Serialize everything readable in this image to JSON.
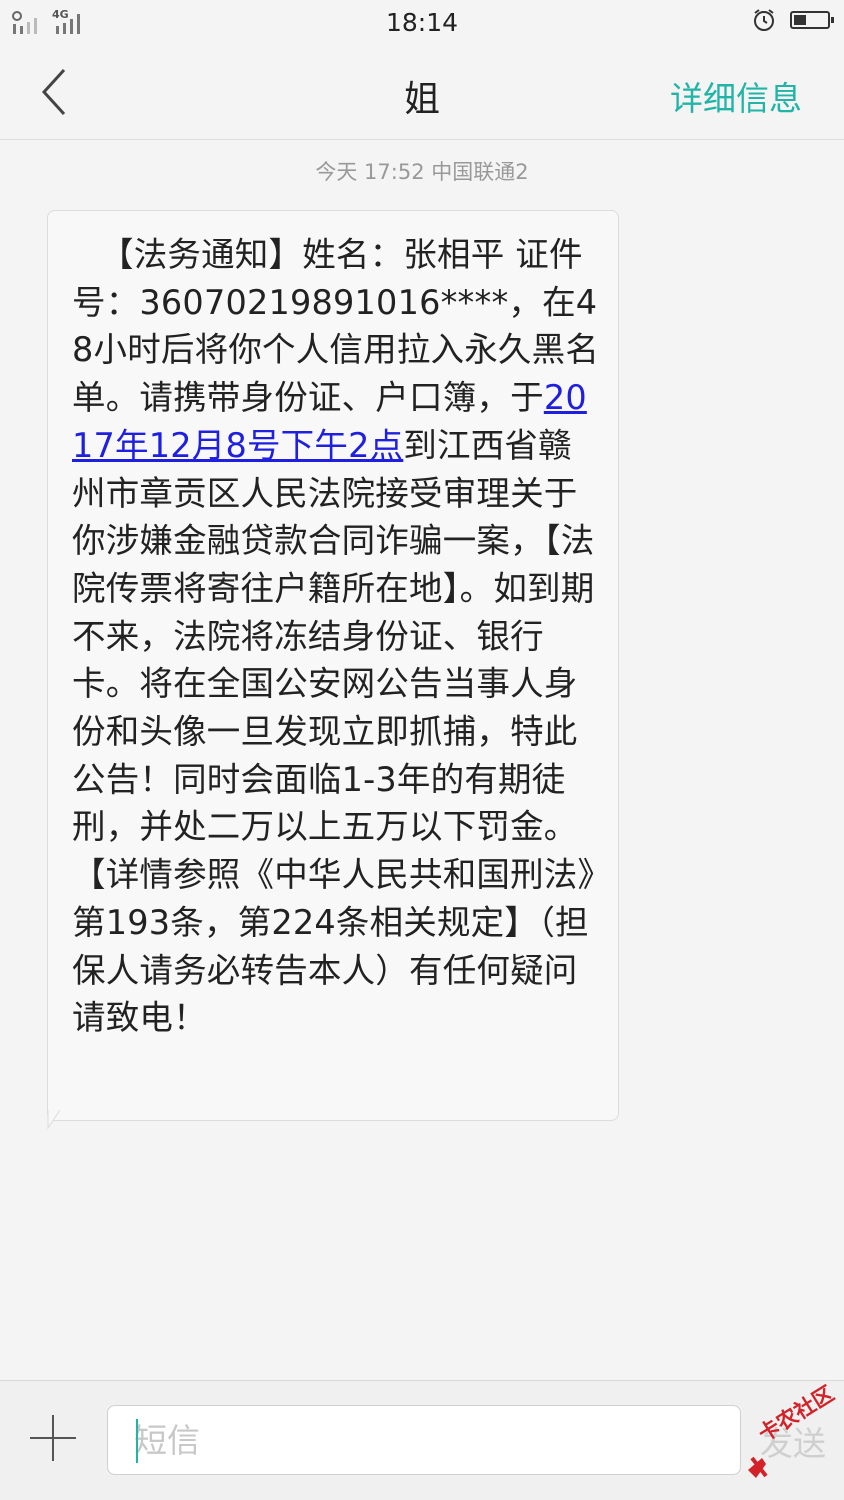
{
  "status_bar": {
    "network_label": "4G",
    "time": "18:14"
  },
  "header": {
    "title": "姐",
    "detail_label": "详细信息"
  },
  "conversation": {
    "timestamp": "今天  17:52  中国联通2",
    "message": {
      "part1": "【法务通知】姓名：张相平 证件号：36070219891016****，在48小时后将你个人信用拉入永久黑名单。请携带身份证、户口簿，于",
      "link": "2017年12月8号下午2点",
      "part2": "到江西省赣州市章贡区人民法院接受审理关于你涉嫌金融贷款合同诈骗一案，【法院传票将寄往户籍所在地】。如到期不来，法院将冻结身份证、银行卡。将在全国公安网公告当事人身份和头像一旦发现立即抓捕，特此公告！同时会面临1-3年的有期徒刑，并处二万以上五万以下罚金。【详情参照《中华人民共和国刑法》第193条，第224条相关规定】（担保人请务必转告本人）有任何疑问请致电！"
    }
  },
  "composer": {
    "placeholder": "短信",
    "send_label": "发送"
  },
  "watermark": {
    "text": "卡农社区"
  },
  "colors": {
    "accent": "#22b5a7",
    "link": "#1f1fe0",
    "watermark": "#d2232a"
  }
}
